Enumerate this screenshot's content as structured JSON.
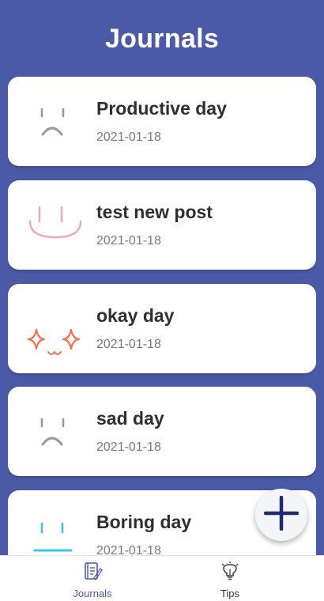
{
  "header": {
    "title": "Journals"
  },
  "journals": [
    {
      "title": "Productive day",
      "date": "2021-01-18",
      "mood_icon": "frown-face-icon"
    },
    {
      "title": "test new post",
      "date": "2021-01-18",
      "mood_icon": "big-smile-face-icon"
    },
    {
      "title": "okay day",
      "date": "2021-01-18",
      "mood_icon": "sparkle-eyes-face-icon"
    },
    {
      "title": "sad day",
      "date": "2021-01-18",
      "mood_icon": "frown-face-icon"
    },
    {
      "title": "Boring day",
      "date": "2021-01-18",
      "mood_icon": "neutral-face-icon"
    }
  ],
  "fab": {
    "icon": "plus-icon"
  },
  "tabbar": {
    "journals_label": "Journals",
    "tips_label": "Tips"
  },
  "colors": {
    "header_bg": "#4a5aa6",
    "accent": "#1f2d6b",
    "frown": "#9a9a9a",
    "smile": "#f4a8a8",
    "sparkle": "#f2704e",
    "neutral": "#3cc2e8"
  }
}
